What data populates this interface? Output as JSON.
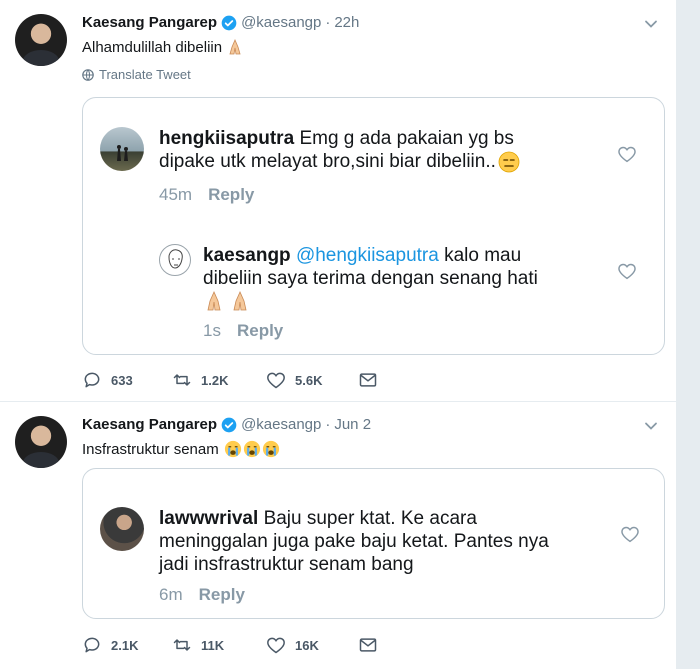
{
  "tweets": [
    {
      "name": "Kaesang Pangarep",
      "handle": "@kaesangp",
      "time": "22h",
      "text": "Alhamdulillah dibeliin",
      "translate": "Translate Tweet",
      "quote": {
        "reply1": {
          "user": "hengkiisaputra",
          "line1": "Emg g ada pakaian yg bs",
          "line2": "dipake utk melayat bro,sini biar dibeliin..",
          "time": "45m",
          "reply_label": "Reply"
        },
        "reply2": {
          "user": "kaesangp",
          "mention": "@hengkiisaputra",
          "line1_rest": "kalo mau",
          "line2": "dibeliin saya terima dengan senang hati",
          "time": "1s",
          "reply_label": "Reply"
        }
      },
      "actions": {
        "replies": "633",
        "retweets": "1.2K",
        "likes": "5.6K"
      }
    },
    {
      "name": "Kaesang Pangarep",
      "handle": "@kaesangp",
      "time": "Jun 2",
      "text": "Insfrastruktur senam",
      "quote": {
        "reply1": {
          "user": "lawwwrival",
          "line1": "Baju super ktat. Ke acara",
          "line2": "meninggalan juga pake baju ketat. Pantes nya",
          "line3": "jadi insfrastruktur senam bang",
          "time": "6m",
          "reply_label": "Reply"
        }
      },
      "actions": {
        "replies": "2.1K",
        "retweets": "11K",
        "likes": "16K"
      }
    }
  ],
  "colors": {
    "accent": "#1b95e0",
    "muted": "#657786",
    "border": "#ccd6dd"
  },
  "icons": [
    "verified-icon",
    "caret-down-icon",
    "globe-icon",
    "heart-icon",
    "reply-icon",
    "retweet-icon",
    "like-icon",
    "dm-icon",
    "praying-hands-emoji",
    "expressionless-emoji",
    "loudly-crying-emoji"
  ]
}
